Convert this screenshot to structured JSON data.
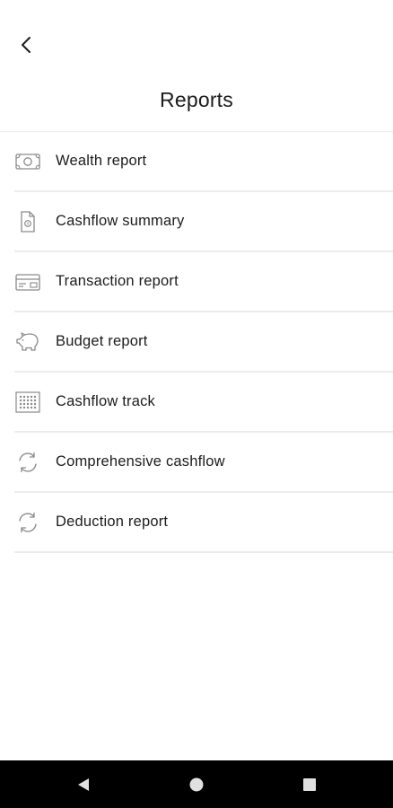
{
  "header": {
    "title": "Reports",
    "back_icon": "chevron-left-icon"
  },
  "reports": [
    {
      "id": "wealth",
      "label": "Wealth report",
      "icon": "banknote-icon"
    },
    {
      "id": "cashflow-summary",
      "label": "Cashflow summary",
      "icon": "document-icon"
    },
    {
      "id": "transaction",
      "label": "Transaction report",
      "icon": "card-icon"
    },
    {
      "id": "budget",
      "label": "Budget report",
      "icon": "piggy-bank-icon"
    },
    {
      "id": "cashflow-track",
      "label": "Cashflow track",
      "icon": "grid-dots-icon"
    },
    {
      "id": "comprehensive-cashflow",
      "label": "Comprehensive cashflow",
      "icon": "refresh-icon"
    },
    {
      "id": "deduction",
      "label": "Deduction report",
      "icon": "refresh-icon"
    }
  ],
  "nav": {
    "back_icon": "nav-back-icon",
    "home_icon": "nav-home-icon",
    "recents_icon": "nav-recents-icon"
  },
  "colors": {
    "text": "#1c1c1c",
    "icon": "#8a8a8a",
    "divider": "#ececec",
    "nav_background": "#000000",
    "nav_icon": "#e0e0e0"
  }
}
